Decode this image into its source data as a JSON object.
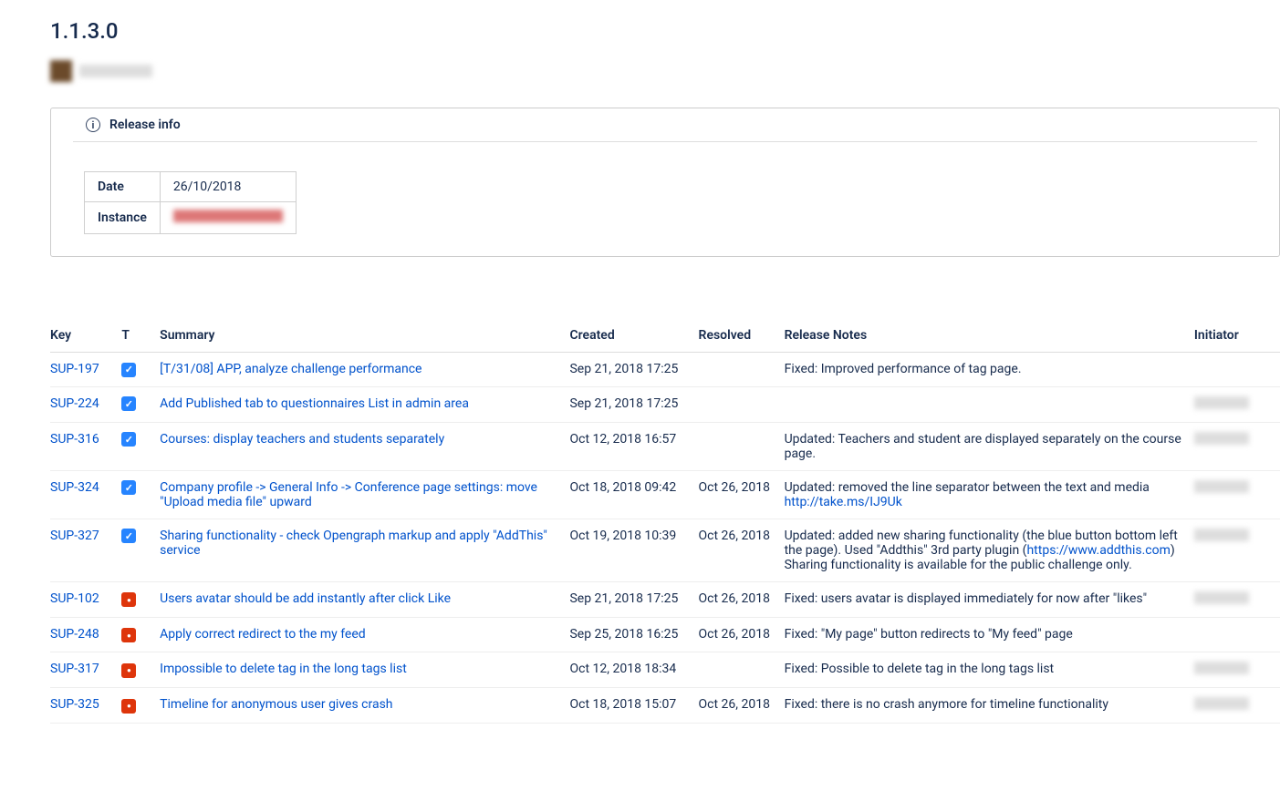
{
  "page_title": "1.1.3.0",
  "panel": {
    "header": "Release info",
    "date_label": "Date",
    "date_value": "26/10/2018",
    "instance_label": "Instance"
  },
  "columns": {
    "key": "Key",
    "type": "T",
    "summary": "Summary",
    "created": "Created",
    "resolved": "Resolved",
    "notes": "Release Notes",
    "initiator": "Initiator"
  },
  "issues": [
    {
      "key": "SUP-197",
      "type": "task",
      "summary": "[T/31/08] APP, analyze challenge performance",
      "created": "Sep 21, 2018 17:25",
      "resolved": "",
      "notes_pre": "Fixed: Improved performance of tag page.",
      "notes_link": "",
      "notes_post": "",
      "initiator_blur": false
    },
    {
      "key": "SUP-224",
      "type": "task",
      "summary": "Add Published tab to questionnaires List in admin area",
      "created": "Sep 21, 2018 17:25",
      "resolved": "",
      "notes_pre": "",
      "notes_link": "",
      "notes_post": "",
      "initiator_blur": true
    },
    {
      "key": "SUP-316",
      "type": "task",
      "summary": "Courses: display teachers and students separately",
      "created": "Oct 12, 2018 16:57",
      "resolved": "",
      "notes_pre": "Updated: Teachers and student are displayed separately on the course page.",
      "notes_link": "",
      "notes_post": "",
      "initiator_blur": true
    },
    {
      "key": "SUP-324",
      "type": "task",
      "summary": "Company profile -> General Info -> Conference page settings: move \"Upload media file\" upward",
      "created": "Oct 18, 2018 09:42",
      "resolved": "Oct 26, 2018",
      "notes_pre": "Updated: removed the line separator between the text and media ",
      "notes_link": "http://take.ms/IJ9Uk",
      "notes_post": "",
      "initiator_blur": true
    },
    {
      "key": "SUP-327",
      "type": "task",
      "summary": "Sharing functionality - check Opengraph markup and apply \"AddThis\" service",
      "created": "Oct 19, 2018 10:39",
      "resolved": "Oct 26, 2018",
      "notes_pre": "Updated: added new sharing functionality (the blue button bottom left the page). Used \"Addthis\" 3rd party plugin (",
      "notes_link": "https://www.addthis.com",
      "notes_post": ")\nSharing functionality is available for the public challenge only.",
      "initiator_blur": true
    },
    {
      "key": "SUP-102",
      "type": "bug",
      "summary": "Users avatar should be add instantly after click Like",
      "created": "Sep 21, 2018 17:25",
      "resolved": "Oct 26, 2018",
      "notes_pre": "Fixed: users avatar is displayed immediately for now after \"likes\"",
      "notes_link": "",
      "notes_post": "",
      "initiator_blur": true
    },
    {
      "key": "SUP-248",
      "type": "bug",
      "summary": "Apply correct redirect to the my feed",
      "created": "Sep 25, 2018 16:25",
      "resolved": "Oct 26, 2018",
      "notes_pre": "Fixed: \"My page\" button redirects to \"My feed\" page",
      "notes_link": "",
      "notes_post": "",
      "initiator_blur": false
    },
    {
      "key": "SUP-317",
      "type": "bug",
      "summary": "Impossible to delete tag in the long tags list",
      "created": "Oct 12, 2018 18:34",
      "resolved": "",
      "notes_pre": "Fixed: Possible to delete tag in the long tags list",
      "notes_link": "",
      "notes_post": "",
      "initiator_blur": true
    },
    {
      "key": "SUP-325",
      "type": "bug",
      "summary": "Timeline for anonymous user gives crash",
      "created": "Oct 18, 2018 15:07",
      "resolved": "Oct 26, 2018",
      "notes_pre": "Fixed: there is no crash anymore for timeline functionality",
      "notes_link": "",
      "notes_post": "",
      "initiator_blur": true
    }
  ]
}
